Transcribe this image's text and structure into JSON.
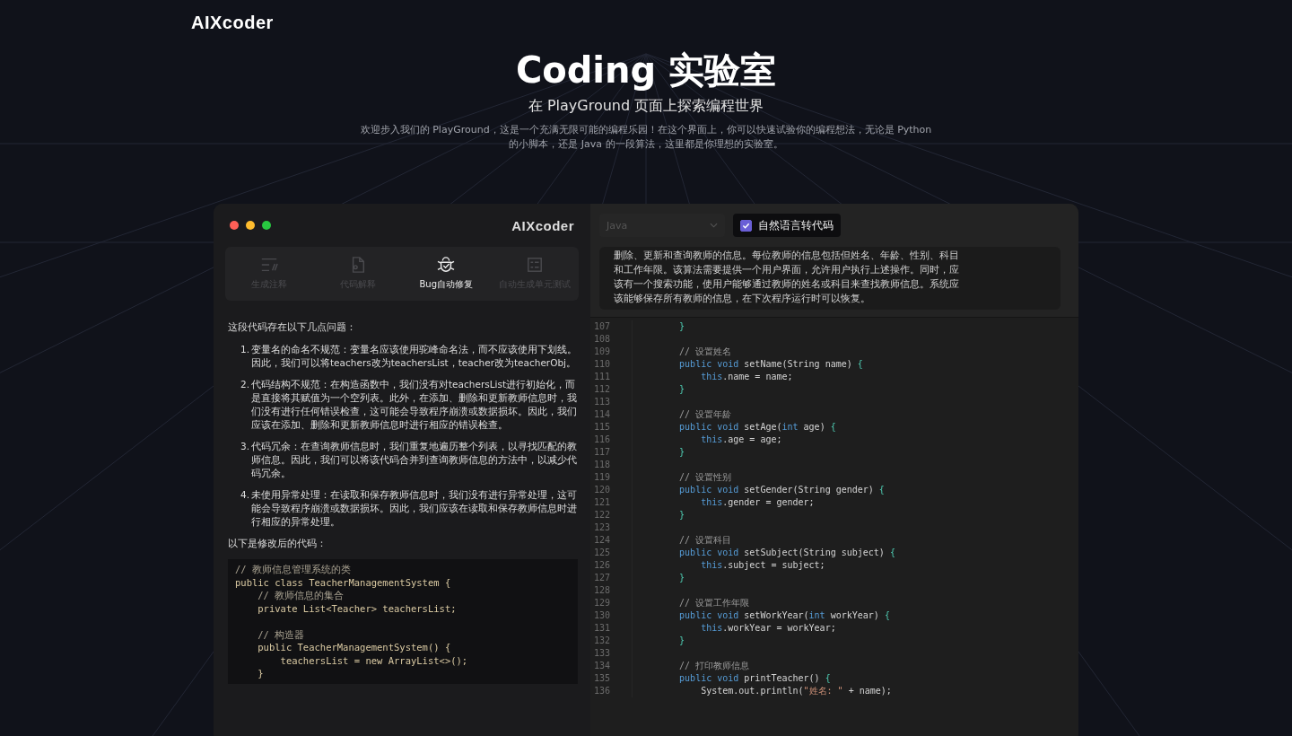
{
  "logo": "AIXcoder",
  "hero": {
    "title": "Coding 实验室",
    "subtitle": "在 PlayGround 页面上探索编程世界",
    "description": "欢迎步入我们的 PlayGround，这是一个充满无限可能的编程乐园！在这个界面上，你可以快速试验你的编程想法，无论是 Python 的小脚本，还是 Java 的一段算法，这里都是你理想的实验室。"
  },
  "window": {
    "logo": "AIXcoder",
    "tabs": [
      {
        "kind": "comment",
        "label": "生成注释",
        "selected": false
      },
      {
        "kind": "explain",
        "label": "代码解释",
        "selected": false
      },
      {
        "kind": "bug",
        "label": "Bug自动修复",
        "selected": true
      },
      {
        "kind": "test",
        "label": "自动生成单元测试",
        "selected": false
      }
    ],
    "answer": {
      "intro": "这段代码存在以下几点问题：",
      "items": [
        {
          "number": "1.",
          "text": "变量名的命名不规范：变量名应该使用驼峰命名法，而不应该使用下划线。因此，我们可以将teachers改为teachersList，teacher改为teacherObj。"
        },
        {
          "number": "2.",
          "text": "代码结构不规范：在构造函数中，我们没有对teachersList进行初始化，而是直接将其赋值为一个空列表。此外，在添加、删除和更新教师信息时，我们没有进行任何错误检查，这可能会导致程序崩溃或数据损坏。因此，我们应该在添加、删除和更新教师信息时进行相应的错误检查。"
        },
        {
          "number": "3.",
          "text": "代码冗余：在查询教师信息时，我们重复地遍历整个列表，以寻找匹配的教师信息。因此，我们可以将该代码合并到查询教师信息的方法中，以减少代码冗余。"
        },
        {
          "number": "4.",
          "text": "未使用异常处理：在读取和保存教师信息时，我们没有进行异常处理，这可能会导致程序崩溃或数据损坏。因此，我们应该在读取和保存教师信息时进行相应的异常处理。"
        }
      ],
      "outro": "以下是修改后的代码：",
      "code": [
        {
          "kind": "comment",
          "text": "// 教师信息管理系统的类"
        },
        {
          "kind": "code",
          "text": "public class TeacherManagementSystem {"
        },
        {
          "kind": "comment",
          "text": "    // 教师信息的集合"
        },
        {
          "kind": "code",
          "text": "    private List<Teacher> teachersList;"
        },
        {
          "kind": "blank"
        },
        {
          "kind": "comment",
          "text": "    // 构造器"
        },
        {
          "kind": "code",
          "text": "    public TeacherManagementSystem() {"
        },
        {
          "kind": "code",
          "text": "        teachersList = new ArrayList<>();"
        },
        {
          "kind": "code",
          "text": "    }"
        }
      ]
    },
    "language_select": {
      "value": "Java",
      "disabled": true
    },
    "nl_to_code": {
      "label": "自然语言转代码",
      "checked": true
    },
    "prompt": "删除、更新和查询教师的信息。每位教师的信息包括但姓名、年龄、性别、科目和工作年限。该算法需要提供一个用户界面，允许用户执行上述操作。同时，应该有一个搜索功能，使用户能够通过教师的姓名或科目来查找教师信息。系统应该能够保存所有教师的信息，在下次程序运行时可以恢复。",
    "editor": [
      {
        "number": "107",
        "tokens": [
          {
            "kind": "punct",
            "text": "    }"
          }
        ]
      },
      {
        "number": "108"
      },
      {
        "number": "109",
        "tokens": [
          {
            "kind": "comment",
            "text": "    // 设置姓名"
          }
        ]
      },
      {
        "number": "110",
        "tokens": [
          {
            "kind": "keyword",
            "text": "    public void "
          },
          {
            "kind": "plain",
            "text": "setName(String name) "
          },
          {
            "kind": "punct",
            "text": "{"
          }
        ]
      },
      {
        "number": "111",
        "tokens": [
          {
            "kind": "keyword",
            "text": "        this"
          },
          {
            "kind": "plain",
            "text": ".name = name;"
          }
        ]
      },
      {
        "number": "112",
        "tokens": [
          {
            "kind": "punct",
            "text": "    }"
          }
        ]
      },
      {
        "number": "113"
      },
      {
        "number": "114",
        "tokens": [
          {
            "kind": "comment",
            "text": "    // 设置年龄"
          }
        ]
      },
      {
        "number": "115",
        "tokens": [
          {
            "kind": "keyword",
            "text": "    public void "
          },
          {
            "kind": "plain",
            "text": "setAge("
          },
          {
            "kind": "keyword",
            "text": "int"
          },
          {
            "kind": "plain",
            "text": " age) "
          },
          {
            "kind": "punct",
            "text": "{"
          }
        ]
      },
      {
        "number": "116",
        "tokens": [
          {
            "kind": "keyword",
            "text": "        this"
          },
          {
            "kind": "plain",
            "text": ".age = age;"
          }
        ]
      },
      {
        "number": "117",
        "tokens": [
          {
            "kind": "punct",
            "text": "    }"
          }
        ]
      },
      {
        "number": "118"
      },
      {
        "number": "119",
        "tokens": [
          {
            "kind": "comment",
            "text": "    // 设置性别"
          }
        ]
      },
      {
        "number": "120",
        "tokens": [
          {
            "kind": "keyword",
            "text": "    public void "
          },
          {
            "kind": "plain",
            "text": "setGender(String gender) "
          },
          {
            "kind": "punct",
            "text": "{"
          }
        ]
      },
      {
        "number": "121",
        "tokens": [
          {
            "kind": "keyword",
            "text": "        this"
          },
          {
            "kind": "plain",
            "text": ".gender = gender;"
          }
        ]
      },
      {
        "number": "122",
        "tokens": [
          {
            "kind": "punct",
            "text": "    }"
          }
        ]
      },
      {
        "number": "123"
      },
      {
        "number": "124",
        "tokens": [
          {
            "kind": "comment",
            "text": "    // 设置科目"
          }
        ]
      },
      {
        "number": "125",
        "tokens": [
          {
            "kind": "keyword",
            "text": "    public void "
          },
          {
            "kind": "plain",
            "text": "setSubject(String subject) "
          },
          {
            "kind": "punct",
            "text": "{"
          }
        ]
      },
      {
        "number": "126",
        "tokens": [
          {
            "kind": "keyword",
            "text": "        this"
          },
          {
            "kind": "plain",
            "text": ".subject = subject;"
          }
        ]
      },
      {
        "number": "127",
        "tokens": [
          {
            "kind": "punct",
            "text": "    }"
          }
        ]
      },
      {
        "number": "128"
      },
      {
        "number": "129",
        "tokens": [
          {
            "kind": "comment",
            "text": "    // 设置工作年限"
          }
        ]
      },
      {
        "number": "130",
        "tokens": [
          {
            "kind": "keyword",
            "text": "    public void "
          },
          {
            "kind": "plain",
            "text": "setWorkYear("
          },
          {
            "kind": "keyword",
            "text": "int"
          },
          {
            "kind": "plain",
            "text": " workYear) "
          },
          {
            "kind": "punct",
            "text": "{"
          }
        ]
      },
      {
        "number": "131",
        "tokens": [
          {
            "kind": "keyword",
            "text": "        this"
          },
          {
            "kind": "plain",
            "text": ".workYear = workYear;"
          }
        ]
      },
      {
        "number": "132",
        "tokens": [
          {
            "kind": "punct",
            "text": "    }"
          }
        ]
      },
      {
        "number": "133"
      },
      {
        "number": "134",
        "tokens": [
          {
            "kind": "comment",
            "text": "    // 打印教师信息"
          }
        ]
      },
      {
        "number": "135",
        "tokens": [
          {
            "kind": "keyword",
            "text": "    public void "
          },
          {
            "kind": "plain",
            "text": "printTeacher() "
          },
          {
            "kind": "punct",
            "text": "{"
          }
        ]
      },
      {
        "number": "136",
        "tokens": [
          {
            "kind": "plain",
            "text": "        System.out.println("
          },
          {
            "kind": "string",
            "text": "\"姓名: \""
          },
          {
            "kind": "plain",
            "text": " + name);"
          }
        ]
      }
    ]
  }
}
